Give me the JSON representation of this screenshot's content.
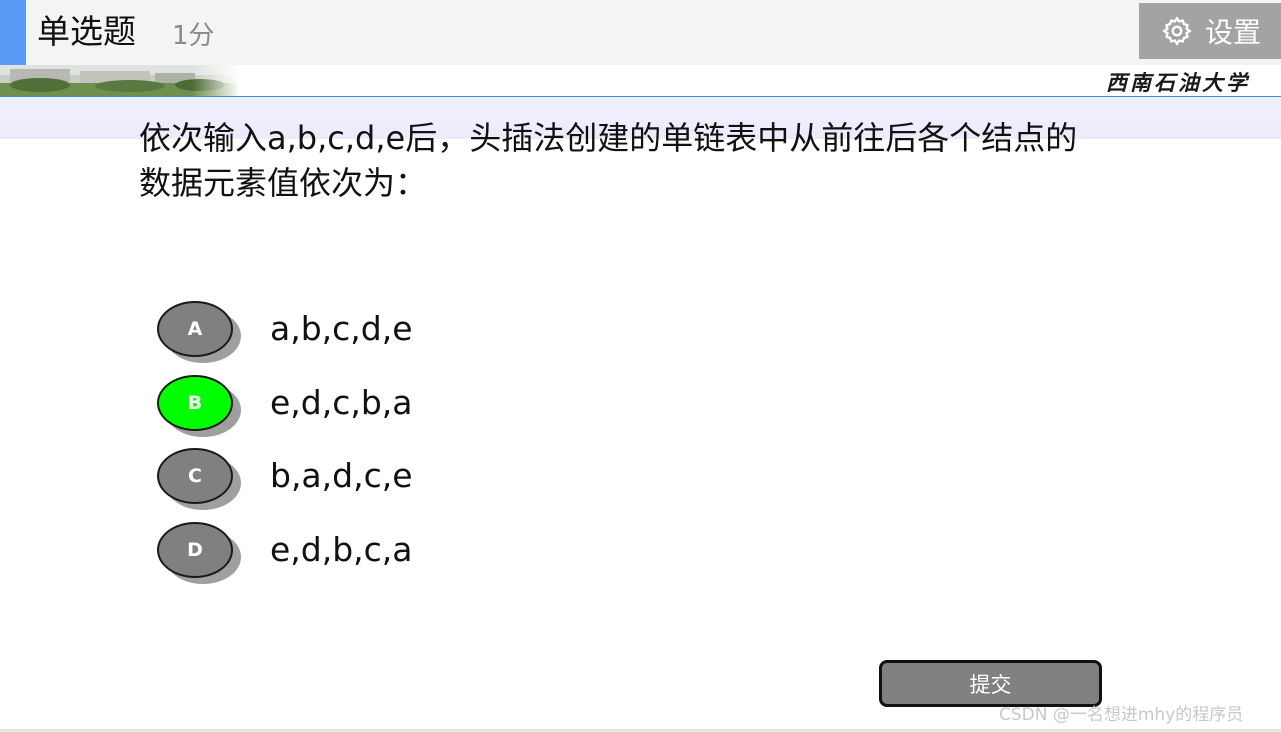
{
  "header": {
    "title": "单选题",
    "score": "1分",
    "settings_label": "设置"
  },
  "banner": {
    "university_name": "西南石油大学"
  },
  "question": {
    "line1": "依次输入a,b,c,d,e后，头插法创建的单链表中从前往后各个结点的",
    "line2": "数据元素值依次为："
  },
  "options": [
    {
      "letter": "A",
      "text": "a,b,c,d,e",
      "selected": false
    },
    {
      "letter": "B",
      "text": "e,d,c,b,a",
      "selected": true
    },
    {
      "letter": "C",
      "text": "b,a,d,c,e",
      "selected": false
    },
    {
      "letter": "D",
      "text": "e,d,b,c,a",
      "selected": false
    }
  ],
  "submit_label": "提交",
  "watermark": "CSDN @一名想进mhy的程序员",
  "colors": {
    "accent": "#5a9bf5",
    "selected": "#00ff00",
    "option_default": "#808080",
    "button": "#a3a3a3"
  },
  "icons": {
    "settings": "gear-icon"
  }
}
